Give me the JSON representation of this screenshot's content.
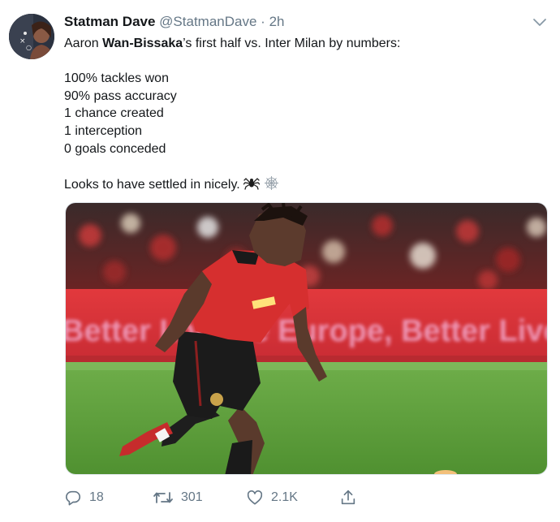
{
  "tweet": {
    "display_name": "Statman Dave",
    "handle": "@StatmanDave",
    "separator": "·",
    "time": "2h",
    "text": {
      "line1_pre": "Aaron ",
      "line1_bold": "Wan-Bissaka",
      "line1_post": "’s first half vs. Inter Milan by numbers:",
      "stats": [
        "100% tackles won",
        "90% pass accuracy",
        "1 chance created",
        "1 interception",
        "0 goals conceded"
      ],
      "closing": "Looks to have settled in nicely."
    },
    "media": {
      "banner_text": "Better Live   Be Europe, Better Live"
    },
    "actions": {
      "replies": "18",
      "retweets": "301",
      "likes": "2.1K"
    }
  },
  "icons": [
    "avatar",
    "chevron-down-icon",
    "spider-icon",
    "spider-web-icon",
    "reply-icon",
    "retweet-icon",
    "like-icon",
    "share-icon"
  ],
  "colors": {
    "text_primary": "#14171a",
    "text_secondary": "#657786",
    "border": "#e1e8ed"
  }
}
